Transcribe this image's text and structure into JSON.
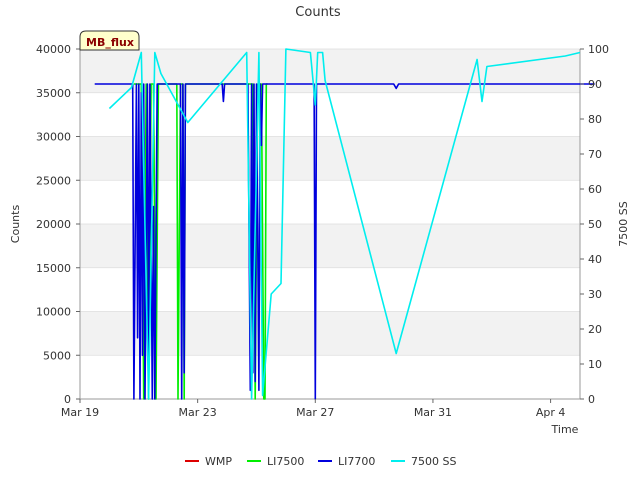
{
  "chart_data": {
    "type": "line",
    "title": "Counts",
    "xlabel": "Time",
    "ylabel": "Counts",
    "y2label": "7500 SS",
    "badge": "MB_flux",
    "xlim": [
      "2019-03-19",
      "2019-04-05"
    ],
    "x_ticks": [
      {
        "label": "Mar 19",
        "date": "2019-03-19"
      },
      {
        "label": "Mar 23",
        "date": "2019-03-23"
      },
      {
        "label": "Mar 27",
        "date": "2019-03-27"
      },
      {
        "label": "Mar 31",
        "date": "2019-03-31"
      },
      {
        "label": "Apr 4",
        "date": "2019-04-04"
      }
    ],
    "ylim": [
      0,
      40000
    ],
    "y_ticks": [
      0,
      5000,
      10000,
      15000,
      20000,
      25000,
      30000,
      35000,
      40000
    ],
    "y2lim": [
      0,
      100
    ],
    "y2_ticks": [
      0,
      10,
      20,
      30,
      40,
      50,
      60,
      70,
      80,
      90,
      100
    ],
    "grid": "horizontal bands",
    "legend_position": "bottom",
    "series": [
      {
        "name": "WMP",
        "color": "#dd0000",
        "axis": "left",
        "points": []
      },
      {
        "name": "LI7500",
        "color": "#00ee00",
        "axis": "left",
        "points": [
          [
            "2019-03-20 20:00",
            36000
          ],
          [
            "2019-03-21 02:00",
            36000
          ],
          [
            "2019-03-21 04:00",
            0
          ],
          [
            "2019-03-21 06:00",
            36000
          ],
          [
            "2019-03-21 08:00",
            0
          ],
          [
            "2019-03-21 10:00",
            36000
          ],
          [
            "2019-03-21 12:00",
            36000
          ],
          [
            "2019-03-21 14:00",
            0
          ],
          [
            "2019-03-21 16:00",
            36000
          ],
          [
            "2019-03-21 17:00",
            36000
          ],
          [
            "2019-03-22 07:00",
            36000
          ],
          [
            "2019-03-22 08:00",
            0
          ],
          [
            "2019-03-22 10:00",
            36000
          ],
          [
            "2019-03-22 12:00",
            36000
          ],
          [
            "2019-03-22 13:00",
            0
          ],
          [
            "2019-03-22 14:00",
            36000
          ],
          [
            "2019-03-24 21:00",
            36000
          ],
          [
            "2019-03-24 23:00",
            0
          ],
          [
            "2019-03-25 01:00",
            36000
          ],
          [
            "2019-03-25 04:00",
            36000
          ],
          [
            "2019-03-25 06:00",
            0
          ],
          [
            "2019-03-25 07:00",
            0
          ],
          [
            "2019-03-25 08:00",
            36000
          ],
          [
            "2019-03-25 09:00",
            36000
          ]
        ]
      },
      {
        "name": "LI7700",
        "color": "#0000dd",
        "axis": "left",
        "points": [
          [
            "2019-03-19 12:00",
            36000
          ],
          [
            "2019-03-20 19:00",
            36000
          ],
          [
            "2019-03-20 20:00",
            0
          ],
          [
            "2019-03-20 22:00",
            36000
          ],
          [
            "2019-03-20 23:00",
            7000
          ],
          [
            "2019-03-21 00:00",
            36000
          ],
          [
            "2019-03-21 01:00",
            0
          ],
          [
            "2019-03-21 02:00",
            35000
          ],
          [
            "2019-03-21 03:00",
            5000
          ],
          [
            "2019-03-21 04:00",
            36000
          ],
          [
            "2019-03-21 05:00",
            0
          ],
          [
            "2019-03-21 07:00",
            36000
          ],
          [
            "2019-03-21 08:00",
            3000
          ],
          [
            "2019-03-21 09:00",
            36000
          ],
          [
            "2019-03-21 11:00",
            0
          ],
          [
            "2019-03-21 12:00",
            22000
          ],
          [
            "2019-03-21 13:00",
            0
          ],
          [
            "2019-03-21 15:00",
            36000
          ],
          [
            "2019-03-22 10:00",
            36000
          ],
          [
            "2019-03-22 11:00",
            0
          ],
          [
            "2019-03-22 12:00",
            36000
          ],
          [
            "2019-03-22 13:00",
            3000
          ],
          [
            "2019-03-22 14:00",
            36000
          ],
          [
            "2019-03-23 20:00",
            36000
          ],
          [
            "2019-03-23 21:00",
            34000
          ],
          [
            "2019-03-23 22:00",
            36000
          ],
          [
            "2019-03-24 17:00",
            36000
          ],
          [
            "2019-03-24 19:00",
            1000
          ],
          [
            "2019-03-24 20:00",
            36000
          ],
          [
            "2019-03-24 21:00",
            3000
          ],
          [
            "2019-03-24 22:00",
            36000
          ],
          [
            "2019-03-24 23:00",
            2000
          ],
          [
            "2019-03-25 00:00",
            36000
          ],
          [
            "2019-03-25 02:00",
            1000
          ],
          [
            "2019-03-25 03:00",
            36000
          ],
          [
            "2019-03-25 04:00",
            29000
          ],
          [
            "2019-03-25 05:00",
            36000
          ],
          [
            "2019-03-26 23:00",
            36000
          ],
          [
            "2019-03-27 00:00",
            0
          ],
          [
            "2019-03-27 01:00",
            36000
          ],
          [
            "2019-03-29 16:00",
            36000
          ],
          [
            "2019-03-29 18:00",
            35500
          ],
          [
            "2019-03-29 20:00",
            36000
          ],
          [
            "2019-04-05 12:00",
            36000
          ]
        ]
      },
      {
        "name": "7500 SS",
        "color": "#00eeee",
        "axis": "right",
        "points": [
          [
            "2019-03-20 00:00",
            83
          ],
          [
            "2019-03-20 18:00",
            89
          ],
          [
            "2019-03-21 02:00",
            99
          ],
          [
            "2019-03-21 08:00",
            0
          ],
          [
            "2019-03-21 13:00",
            99
          ],
          [
            "2019-03-21 18:00",
            93
          ],
          [
            "2019-03-22 16:00",
            79
          ],
          [
            "2019-03-24 16:00",
            99
          ],
          [
            "2019-03-24 20:00",
            0
          ],
          [
            "2019-03-25 02:00",
            99
          ],
          [
            "2019-03-25 05:00",
            1
          ],
          [
            "2019-03-25 12:00",
            30
          ],
          [
            "2019-03-25 20:00",
            33
          ],
          [
            "2019-03-26 00:00",
            100
          ],
          [
            "2019-03-26 20:00",
            99
          ],
          [
            "2019-03-27 00:00",
            84
          ],
          [
            "2019-03-27 02:00",
            99
          ],
          [
            "2019-03-27 06:00",
            99
          ],
          [
            "2019-03-27 08:00",
            91
          ],
          [
            "2019-03-29 18:00",
            13
          ],
          [
            "2019-04-01 12:00",
            97
          ],
          [
            "2019-04-01 16:00",
            85
          ],
          [
            "2019-04-01 20:00",
            95
          ],
          [
            "2019-04-04 12:00",
            98
          ],
          [
            "2019-04-05 00:00",
            99
          ]
        ]
      }
    ]
  }
}
